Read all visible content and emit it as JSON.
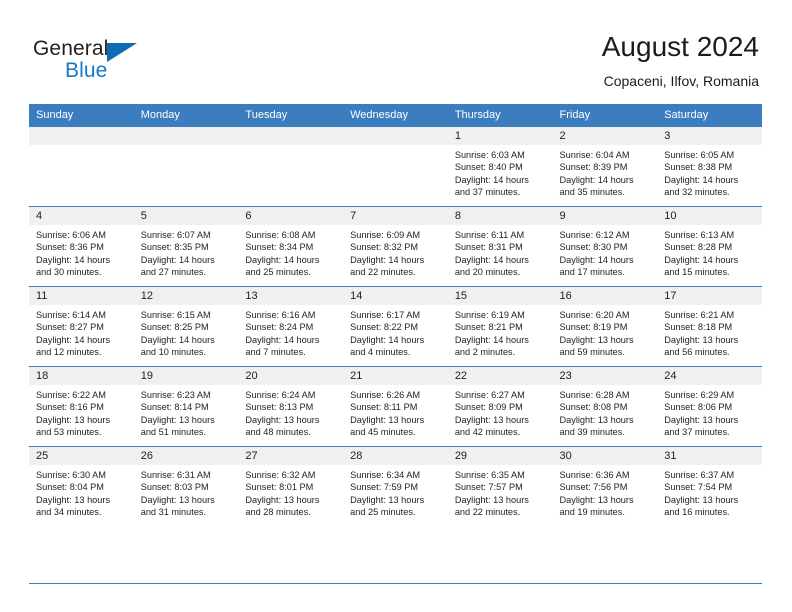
{
  "brand": {
    "name_top": "General",
    "name_bottom": "Blue",
    "accent_color": "#1878c4",
    "triangle_color": "#0f6bb5"
  },
  "header": {
    "title": "August 2024",
    "subtitle": "Copaceni, Ilfov, Romania"
  },
  "theme": {
    "header_bar_color": "#3b7dbf",
    "daynum_band_color": "#f0f0f0",
    "grid_line_color": "#3b7dbf",
    "text_color": "#232323"
  },
  "weekday_headers": [
    "Sunday",
    "Monday",
    "Tuesday",
    "Wednesday",
    "Thursday",
    "Friday",
    "Saturday"
  ],
  "weeks": [
    [
      {
        "day": "",
        "empty": true
      },
      {
        "day": "",
        "empty": true
      },
      {
        "day": "",
        "empty": true
      },
      {
        "day": "",
        "empty": true
      },
      {
        "day": "1",
        "sunrise": "Sunrise: 6:03 AM",
        "sunset": "Sunset: 8:40 PM",
        "daylight_line1": "Daylight: 14 hours",
        "daylight_line2": "and 37 minutes."
      },
      {
        "day": "2",
        "sunrise": "Sunrise: 6:04 AM",
        "sunset": "Sunset: 8:39 PM",
        "daylight_line1": "Daylight: 14 hours",
        "daylight_line2": "and 35 minutes."
      },
      {
        "day": "3",
        "sunrise": "Sunrise: 6:05 AM",
        "sunset": "Sunset: 8:38 PM",
        "daylight_line1": "Daylight: 14 hours",
        "daylight_line2": "and 32 minutes."
      }
    ],
    [
      {
        "day": "4",
        "sunrise": "Sunrise: 6:06 AM",
        "sunset": "Sunset: 8:36 PM",
        "daylight_line1": "Daylight: 14 hours",
        "daylight_line2": "and 30 minutes."
      },
      {
        "day": "5",
        "sunrise": "Sunrise: 6:07 AM",
        "sunset": "Sunset: 8:35 PM",
        "daylight_line1": "Daylight: 14 hours",
        "daylight_line2": "and 27 minutes."
      },
      {
        "day": "6",
        "sunrise": "Sunrise: 6:08 AM",
        "sunset": "Sunset: 8:34 PM",
        "daylight_line1": "Daylight: 14 hours",
        "daylight_line2": "and 25 minutes."
      },
      {
        "day": "7",
        "sunrise": "Sunrise: 6:09 AM",
        "sunset": "Sunset: 8:32 PM",
        "daylight_line1": "Daylight: 14 hours",
        "daylight_line2": "and 22 minutes."
      },
      {
        "day": "8",
        "sunrise": "Sunrise: 6:11 AM",
        "sunset": "Sunset: 8:31 PM",
        "daylight_line1": "Daylight: 14 hours",
        "daylight_line2": "and 20 minutes."
      },
      {
        "day": "9",
        "sunrise": "Sunrise: 6:12 AM",
        "sunset": "Sunset: 8:30 PM",
        "daylight_line1": "Daylight: 14 hours",
        "daylight_line2": "and 17 minutes."
      },
      {
        "day": "10",
        "sunrise": "Sunrise: 6:13 AM",
        "sunset": "Sunset: 8:28 PM",
        "daylight_line1": "Daylight: 14 hours",
        "daylight_line2": "and 15 minutes."
      }
    ],
    [
      {
        "day": "11",
        "sunrise": "Sunrise: 6:14 AM",
        "sunset": "Sunset: 8:27 PM",
        "daylight_line1": "Daylight: 14 hours",
        "daylight_line2": "and 12 minutes."
      },
      {
        "day": "12",
        "sunrise": "Sunrise: 6:15 AM",
        "sunset": "Sunset: 8:25 PM",
        "daylight_line1": "Daylight: 14 hours",
        "daylight_line2": "and 10 minutes."
      },
      {
        "day": "13",
        "sunrise": "Sunrise: 6:16 AM",
        "sunset": "Sunset: 8:24 PM",
        "daylight_line1": "Daylight: 14 hours",
        "daylight_line2": "and 7 minutes."
      },
      {
        "day": "14",
        "sunrise": "Sunrise: 6:17 AM",
        "sunset": "Sunset: 8:22 PM",
        "daylight_line1": "Daylight: 14 hours",
        "daylight_line2": "and 4 minutes."
      },
      {
        "day": "15",
        "sunrise": "Sunrise: 6:19 AM",
        "sunset": "Sunset: 8:21 PM",
        "daylight_line1": "Daylight: 14 hours",
        "daylight_line2": "and 2 minutes."
      },
      {
        "day": "16",
        "sunrise": "Sunrise: 6:20 AM",
        "sunset": "Sunset: 8:19 PM",
        "daylight_line1": "Daylight: 13 hours",
        "daylight_line2": "and 59 minutes."
      },
      {
        "day": "17",
        "sunrise": "Sunrise: 6:21 AM",
        "sunset": "Sunset: 8:18 PM",
        "daylight_line1": "Daylight: 13 hours",
        "daylight_line2": "and 56 minutes."
      }
    ],
    [
      {
        "day": "18",
        "sunrise": "Sunrise: 6:22 AM",
        "sunset": "Sunset: 8:16 PM",
        "daylight_line1": "Daylight: 13 hours",
        "daylight_line2": "and 53 minutes."
      },
      {
        "day": "19",
        "sunrise": "Sunrise: 6:23 AM",
        "sunset": "Sunset: 8:14 PM",
        "daylight_line1": "Daylight: 13 hours",
        "daylight_line2": "and 51 minutes."
      },
      {
        "day": "20",
        "sunrise": "Sunrise: 6:24 AM",
        "sunset": "Sunset: 8:13 PM",
        "daylight_line1": "Daylight: 13 hours",
        "daylight_line2": "and 48 minutes."
      },
      {
        "day": "21",
        "sunrise": "Sunrise: 6:26 AM",
        "sunset": "Sunset: 8:11 PM",
        "daylight_line1": "Daylight: 13 hours",
        "daylight_line2": "and 45 minutes."
      },
      {
        "day": "22",
        "sunrise": "Sunrise: 6:27 AM",
        "sunset": "Sunset: 8:09 PM",
        "daylight_line1": "Daylight: 13 hours",
        "daylight_line2": "and 42 minutes."
      },
      {
        "day": "23",
        "sunrise": "Sunrise: 6:28 AM",
        "sunset": "Sunset: 8:08 PM",
        "daylight_line1": "Daylight: 13 hours",
        "daylight_line2": "and 39 minutes."
      },
      {
        "day": "24",
        "sunrise": "Sunrise: 6:29 AM",
        "sunset": "Sunset: 8:06 PM",
        "daylight_line1": "Daylight: 13 hours",
        "daylight_line2": "and 37 minutes."
      }
    ],
    [
      {
        "day": "25",
        "sunrise": "Sunrise: 6:30 AM",
        "sunset": "Sunset: 8:04 PM",
        "daylight_line1": "Daylight: 13 hours",
        "daylight_line2": "and 34 minutes."
      },
      {
        "day": "26",
        "sunrise": "Sunrise: 6:31 AM",
        "sunset": "Sunset: 8:03 PM",
        "daylight_line1": "Daylight: 13 hours",
        "daylight_line2": "and 31 minutes."
      },
      {
        "day": "27",
        "sunrise": "Sunrise: 6:32 AM",
        "sunset": "Sunset: 8:01 PM",
        "daylight_line1": "Daylight: 13 hours",
        "daylight_line2": "and 28 minutes."
      },
      {
        "day": "28",
        "sunrise": "Sunrise: 6:34 AM",
        "sunset": "Sunset: 7:59 PM",
        "daylight_line1": "Daylight: 13 hours",
        "daylight_line2": "and 25 minutes."
      },
      {
        "day": "29",
        "sunrise": "Sunrise: 6:35 AM",
        "sunset": "Sunset: 7:57 PM",
        "daylight_line1": "Daylight: 13 hours",
        "daylight_line2": "and 22 minutes."
      },
      {
        "day": "30",
        "sunrise": "Sunrise: 6:36 AM",
        "sunset": "Sunset: 7:56 PM",
        "daylight_line1": "Daylight: 13 hours",
        "daylight_line2": "and 19 minutes."
      },
      {
        "day": "31",
        "sunrise": "Sunrise: 6:37 AM",
        "sunset": "Sunset: 7:54 PM",
        "daylight_line1": "Daylight: 13 hours",
        "daylight_line2": "and 16 minutes."
      }
    ]
  ]
}
